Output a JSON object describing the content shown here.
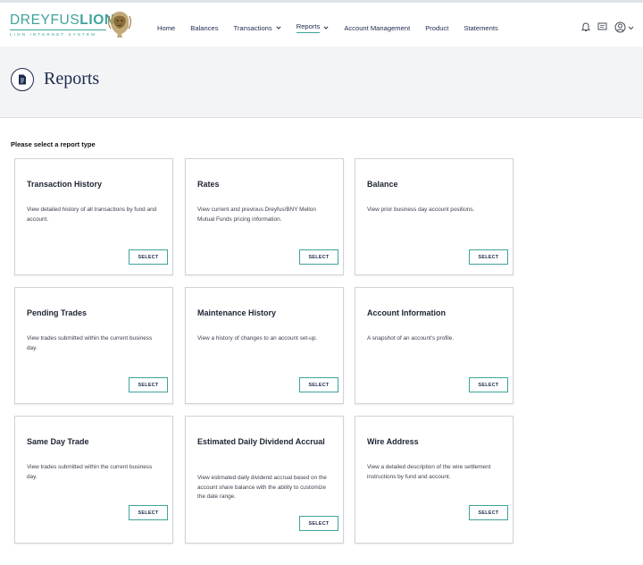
{
  "brand": {
    "name_light": "DREYFUS",
    "name_bold": "LION",
    "subtitle": "LION INTERNET SYSTEM",
    "accent": "#3fa39b",
    "navy": "#1d2a4d"
  },
  "nav": {
    "items": [
      {
        "label": "Home",
        "dropdown": false,
        "active": false
      },
      {
        "label": "Balances",
        "dropdown": false,
        "active": false
      },
      {
        "label": "Transactions",
        "dropdown": true,
        "active": false
      },
      {
        "label": "Reports",
        "dropdown": true,
        "active": true
      },
      {
        "label": "Account Management",
        "dropdown": false,
        "active": false
      },
      {
        "label": "Product",
        "dropdown": false,
        "active": false
      },
      {
        "label": "Statements",
        "dropdown": false,
        "active": false
      }
    ],
    "right_icons": [
      "bell-icon",
      "message-icon",
      "user-icon",
      "chevron-down-icon"
    ]
  },
  "page": {
    "title": "Reports",
    "icon": "document-icon",
    "prompt": "Please select a report type"
  },
  "reports": [
    {
      "title": "Transaction History",
      "description": "View detailed history of all transactions by fund and account.",
      "button": "SELECT"
    },
    {
      "title": "Rates",
      "description": "View current and previous Dreyfus/BNY Mellon Mutual Funds pricing information.",
      "button": "SELECT"
    },
    {
      "title": "Balance",
      "description": "View prior business day account positions.",
      "button": "SELECT"
    },
    {
      "title": "Pending Trades",
      "description": "View trades submitted within the current business day.",
      "button": "SELECT"
    },
    {
      "title": "Maintenance History",
      "description": "View a history of changes to an account set-up.",
      "button": "SELECT"
    },
    {
      "title": "Account Information",
      "description": "A snapshot of an account's profile.",
      "button": "SELECT"
    },
    {
      "title": "Same Day Trade",
      "description": "View trades submitted within the current business day.",
      "button": "SELECT"
    },
    {
      "title": "Estimated Daily Dividend Accrual",
      "description": "View estimated daily dividend accrual based on the account share balance with the ability to customize the date range.",
      "button": "SELECT"
    },
    {
      "title": "Wire Address",
      "description": "View a detailed description of the wire settlement instructions by fund and account.",
      "button": "SELECT"
    }
  ]
}
